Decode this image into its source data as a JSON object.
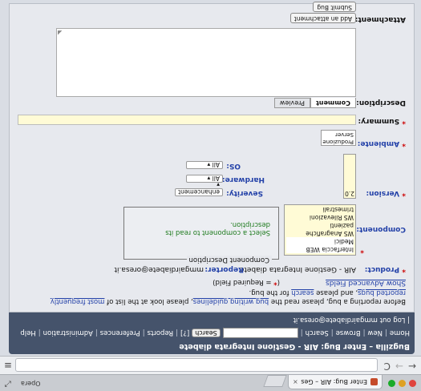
{
  "browser": {
    "tab_title": "Enter Bug: AIR – Gestione...",
    "tab_close": "×",
    "brand": "Opera",
    "nav_back": "←",
    "nav_forward": "→",
    "nav_reload": "C",
    "menu": "≡"
  },
  "header": {
    "title": "Bugzilla – Enter Bug: AIR - Gestione Integrata diabete",
    "links": [
      "Home",
      "New",
      "Browse",
      "Search"
    ],
    "search_button": "Search",
    "help_mark": "[?]",
    "links2": [
      "Reports",
      "Preferences",
      "Administration",
      "Help"
    ],
    "logout_text": "Log out",
    "user_email": "mmgairdiabete@oresa.it"
  },
  "form": {
    "intro_before": "Before reporting a bug, please read the ",
    "intro_link1": "bug writing guidelines",
    "intro_middle": ", please look at the list of ",
    "intro_link2": "most frequently reported bugs",
    "intro_and": ", and please ",
    "intro_link3": "search",
    "intro_end": " for the bug.",
    "advanced_link": "Show Advanced Fields",
    "required_star": "*",
    "required_note": " = Required Field)",
    "required_open": "(",
    "product_label": "Product:",
    "product_value": "AIR - Gestione Integrata diabete",
    "reporter_label": "Reporter:",
    "reporter_value": "mmgairdiabete@oresa.it",
    "component_label": "Component:",
    "component_options": [
      "Interfaccia WEB Medici",
      "WS Anagrafiche pazienti",
      "WS Rilevazioni trimestrali"
    ],
    "component_desc_caption": "Component Description",
    "component_desc_text": "Select a component to read its description.",
    "version_label": "Version:",
    "version_value": "2.0",
    "severity_label": "Severity:",
    "severity_value": "enhancement",
    "hardware_label": "Hardware:",
    "hardware_value": "All",
    "os_label": "OS:",
    "os_value": "All",
    "ambiente_label": "Ambiente:",
    "ambiente_options": [
      "Produzione",
      "Server"
    ],
    "summary_label": "Summary:",
    "description_label": "Description:",
    "tab_comment": "Comment",
    "tab_preview": "Preview",
    "attachment_label": "Attachment:",
    "add_attachment_button": "Add an attachment",
    "submit_button": "Submit Bug"
  }
}
